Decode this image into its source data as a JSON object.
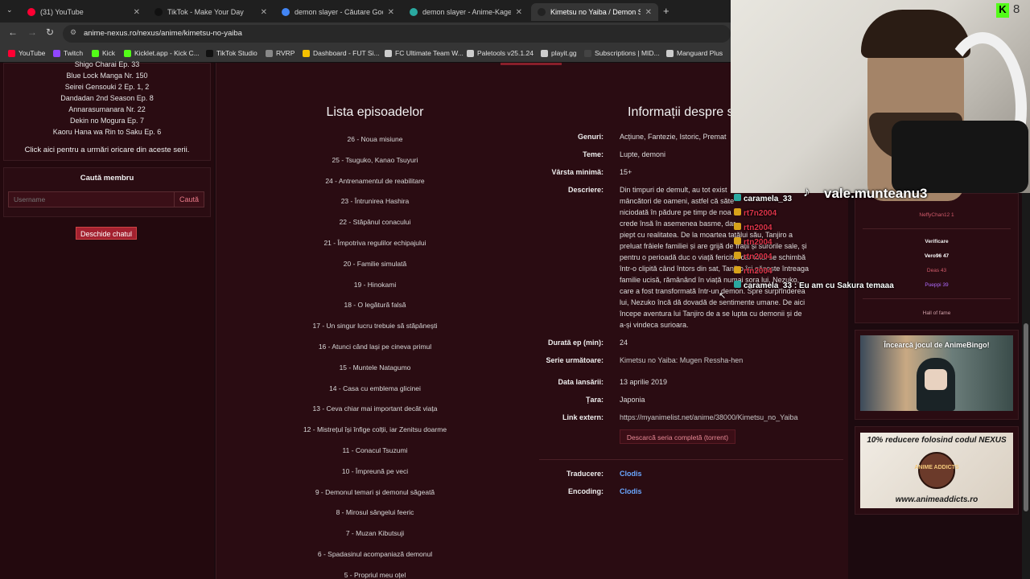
{
  "browser": {
    "tabs": [
      {
        "title": "(31) YouTube",
        "color": "#ff0033"
      },
      {
        "title": "TikTok - Make Your Day",
        "color": "#111111"
      },
      {
        "title": "demon slayer - Căutare Google",
        "color": "#4285f4"
      },
      {
        "title": "demon slayer - Anime-Kage | A",
        "color": "#2aa9a0"
      },
      {
        "title": "Kimetsu no Yaiba / Demon Slay",
        "color": "#222222"
      }
    ],
    "url": "anime-nexus.ro/nexus/anime/kimetsu-no-yaiba",
    "bookmarks": [
      {
        "label": "YouTube",
        "color": "#ff0033"
      },
      {
        "label": "Twitch",
        "color": "#9146ff"
      },
      {
        "label": "Kick",
        "color": "#53fc18"
      },
      {
        "label": "Kicklet.app - Kick C...",
        "color": "#53fc18"
      },
      {
        "label": "TikTok Studio",
        "color": "#111111"
      },
      {
        "label": "RVRP",
        "color": "#888888"
      },
      {
        "label": "Dashboard - FUT Si...",
        "color": "#f5c000"
      },
      {
        "label": "FC Ultimate Team W...",
        "color": "#cccccc"
      },
      {
        "label": "Paletools v25.1.24",
        "color": "#cccccc"
      },
      {
        "label": "playit.gg",
        "color": "#cccccc"
      },
      {
        "label": "Subscriptions | MID...",
        "color": "#444444"
      },
      {
        "label": "Manguard Plus",
        "color": "#cccccc"
      }
    ]
  },
  "sidebar": {
    "series": [
      "Shigo Charai Ep. 33",
      "Blue Lock Manga Nr. 150",
      "Seirei Gensouki 2 Ep. 1, 2",
      "Dandadan 2nd Season Ep. 8",
      "Annarasumanara Nr. 22",
      "Dekin no Mogura Ep. 7",
      "Kaoru Hana wa Rin to Saku Ep. 6"
    ],
    "follow_text": "Click aici pentru a urmări oricare din aceste serii.",
    "search_title": "Caută membru",
    "search_placeholder": "Username",
    "search_button": "Caută",
    "chat_button": "Deschide chatul"
  },
  "episodes": {
    "title": "Lista episoadelor",
    "items": [
      "26 - Noua misiune",
      "25 - Tsuguko, Kanao Tsuyuri",
      "24 - Antrenamentul de reabilitare",
      "23 - Întrunirea Hashira",
      "22 - Stăpânul conacului",
      "21 - Împotriva regulilor echipajului",
      "20 - Familie simulată",
      "19 - Hinokami",
      "18 - O legătură falsă",
      "17 - Un singur lucru trebuie să stăpânești",
      "16 - Atunci când lași pe cineva primul",
      "15 - Muntele Natagumo",
      "14 - Casa cu emblema glicinei",
      "13 - Ceva chiar mai important decât viața",
      "12 - Mistrețul își înfige colții, iar Zenitsu doarme",
      "11 - Conacul Tsuzumi",
      "10 - Împreună pe veci",
      "9 - Demonul temari și demonul săgeată",
      "8 - Mirosul sângelui feeric",
      "7 - Muzan Kibutsuji",
      "6 - Spadasinul acompaniază demonul",
      "5 - Propriul meu oțel"
    ]
  },
  "info": {
    "title": "Informații despre s",
    "genres_label": "Genuri:",
    "genres": "Acțiune, Fantezie, Istoric, Premat",
    "themes_label": "Teme:",
    "themes": "Lupte, demoni",
    "age_label": "Vârsta minimă:",
    "age": "15+",
    "desc_label": "Descriere:",
    "desc": [
      "Din timpuri de demult, au tot exist",
      "mâncători de oameni, astfel că săte",
      "niciodată în pădure pe timp de noa",
      "crede însă în asemenea basme, dar",
      "piept cu realitatea. De la moartea tatălui său, Tanjiro a",
      "preluat frâiele familiei și are grijă de frații și surorile sale, și",
      "pentru o perioadă duc o viață fericită, dar totul se schimbă",
      "într-o clipită când întors din sat, Tanjiro își găsește întreaga",
      "familie ucisă, rămânând în viață numai sora lui, Nezuko,",
      "care a fost transformată într-un demon. Spre surprinderea",
      "lui, Nezuko încă dă dovadă de sentimente umane. De aici",
      "începe aventura lui Tanjiro de a se lupta cu demonii și de",
      "a-și vindeca surioara."
    ],
    "duration_label": "Durată ep (min):",
    "duration": "24",
    "next_label": "Serie următoare:",
    "next": "Kimetsu no Yaiba: Mugen Ressha-hen",
    "date_label": "Data lansării:",
    "date": "13 aprilie 2019",
    "country_label": "Țara:",
    "country": "Japonia",
    "link_label": "Link extern:",
    "link": "https://myanimelist.net/anime/38000/Kimetsu_no_Yaiba",
    "download": "Descarcă seria completă (torrent)",
    "trans_label": "Traducere:",
    "trans": "Clodis",
    "enc_label": "Encoding:",
    "enc": "Clodis"
  },
  "right": {
    "top_user": "NeffyChan12 1",
    "verif_title": "Verificare",
    "verif_users": [
      "Vero96 47",
      "Deas 43",
      "Pueppi 39"
    ],
    "hall": "Hall of fame",
    "bingo": "Încearcă jocul de AnimeBingo!",
    "promo": "10% reducere folosind codul NEXUS",
    "promo_brand": "ANIME ADDICTS",
    "promo_url": "www.animeaddicts.ro"
  },
  "overlay": {
    "streamer": "vale.munteanu3",
    "kick_count": "8",
    "chat": [
      {
        "user": "caramela_33",
        "text": ""
      },
      {
        "user": "rt7n2004",
        "text": ""
      },
      {
        "user": "rtn2004",
        "text": ""
      },
      {
        "user": "rtn2004",
        "text": ""
      },
      {
        "user": "rtn2004",
        "text": ""
      },
      {
        "user": "rtn2004",
        "text": ""
      },
      {
        "user": "caramela_33",
        "text": "Eu am cu Sakura temaaa"
      }
    ]
  }
}
